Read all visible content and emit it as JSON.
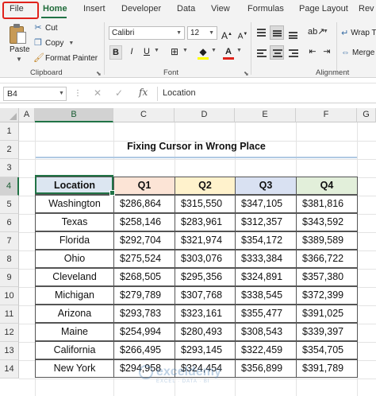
{
  "ribbon_tabs": [
    "File",
    "Home",
    "Insert",
    "Developer",
    "Data",
    "View",
    "Formulas",
    "Page Layout",
    "Rev"
  ],
  "clipboard": {
    "paste_label": "Paste",
    "cut_label": "Cut",
    "copy_label": "Copy",
    "format_painter_label": "Format Painter",
    "group_label": "Clipboard"
  },
  "font": {
    "family": "Calibri",
    "size": "12",
    "bold_label": "B",
    "italic_label": "I",
    "underline_label": "U",
    "group_label": "Font"
  },
  "alignment": {
    "wrap_label": "Wrap T",
    "merge_label": "Merge",
    "group_label": "Alignment"
  },
  "formula_bar": {
    "name_box": "B4",
    "fx_label": "fx",
    "value": "Location"
  },
  "columns": [
    "A",
    "B",
    "C",
    "D",
    "E",
    "F",
    "G"
  ],
  "rows": [
    "1",
    "2",
    "3",
    "4",
    "5",
    "6",
    "7",
    "8",
    "9",
    "10",
    "11",
    "12",
    "13",
    "14"
  ],
  "sheet_title": "Fixing Cursor in Wrong Place",
  "table": {
    "headers": [
      "Location",
      "Q1",
      "Q2",
      "Q3",
      "Q4"
    ],
    "rows": [
      [
        "Washington",
        "$286,864",
        "$315,550",
        "$347,105",
        "$381,816"
      ],
      [
        "Texas",
        "$258,146",
        "$283,961",
        "$312,357",
        "$343,592"
      ],
      [
        "Florida",
        "$292,704",
        "$321,974",
        "$354,172",
        "$389,589"
      ],
      [
        "Ohio",
        "$275,524",
        "$303,076",
        "$333,384",
        "$366,722"
      ],
      [
        "Cleveland",
        "$268,505",
        "$295,356",
        "$324,891",
        "$357,380"
      ],
      [
        "Michigan",
        "$279,789",
        "$307,768",
        "$338,545",
        "$372,399"
      ],
      [
        "Arizona",
        "$293,783",
        "$323,161",
        "$355,477",
        "$391,025"
      ],
      [
        "Maine",
        "$254,994",
        "$280,493",
        "$308,543",
        "$339,397"
      ],
      [
        "California",
        "$266,495",
        "$293,145",
        "$322,459",
        "$354,705"
      ],
      [
        "New York",
        "$294,958",
        "$324,454",
        "$356,899",
        "$391,789"
      ]
    ]
  },
  "header_colors": [
    "#dce6f1",
    "#fce4d6",
    "#fff2cc",
    "#d9e1f2",
    "#e2efda"
  ],
  "colors": {
    "accent": "#217346",
    "file_highlight": "#e0221b"
  },
  "watermark": {
    "name": "exceldemy",
    "tagline": "EXCEL · DATA · BI"
  }
}
